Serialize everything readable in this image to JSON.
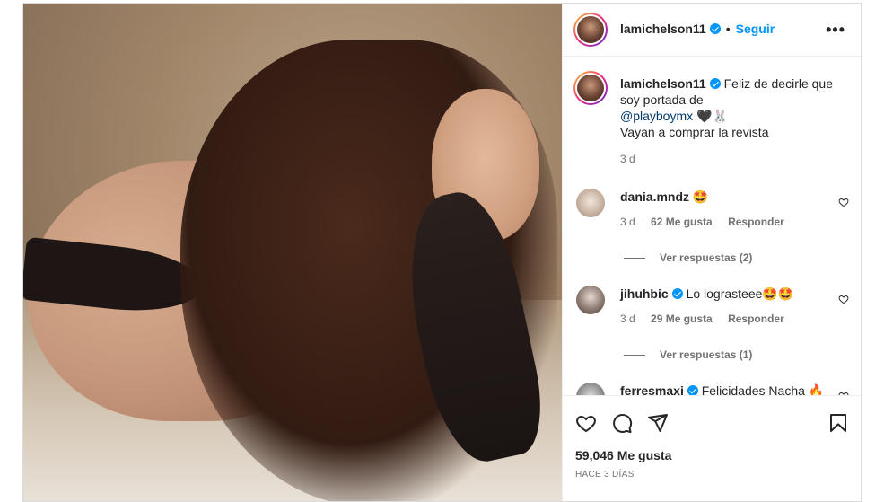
{
  "post": {
    "author": "lamichelson11",
    "follow_label": "Seguir",
    "separator": "•",
    "more": "•••"
  },
  "caption": {
    "author": "lamichelson11",
    "text_line1": "Feliz de decirle que",
    "text_line2": "soy portada de",
    "mention": "@playboymx",
    "emoji": "🖤🐰",
    "text_line4": "Vayan a comprar la revista",
    "time": "3 d"
  },
  "comments": [
    {
      "user": "dania.mndz",
      "verified": false,
      "text": "🤩",
      "time": "3 d",
      "likes": "62 Me gusta",
      "reply_label": "Responder",
      "view_replies": "Ver respuestas (2)"
    },
    {
      "user": "jihuhbic",
      "verified": true,
      "text": "Lo lograsteee🤩🤩",
      "time": "3 d",
      "likes": "29 Me gusta",
      "reply_label": "Responder",
      "view_replies": "Ver respuestas (1)"
    },
    {
      "user": "ferresmaxi",
      "verified": true,
      "text": "Felicidades Nacha 🔥"
    }
  ],
  "footer": {
    "likes_count": "59,046 Me gusta",
    "posted_ago": "HACE 3 DÍAS"
  },
  "icons": {
    "like": "heart-icon",
    "comment": "comment-icon",
    "share": "paper-plane-icon",
    "save": "bookmark-icon",
    "verified": "verified-badge-icon"
  },
  "colors": {
    "accent_blue": "#0095f6",
    "mention": "#00376b",
    "muted": "#737373",
    "text": "#262626"
  }
}
